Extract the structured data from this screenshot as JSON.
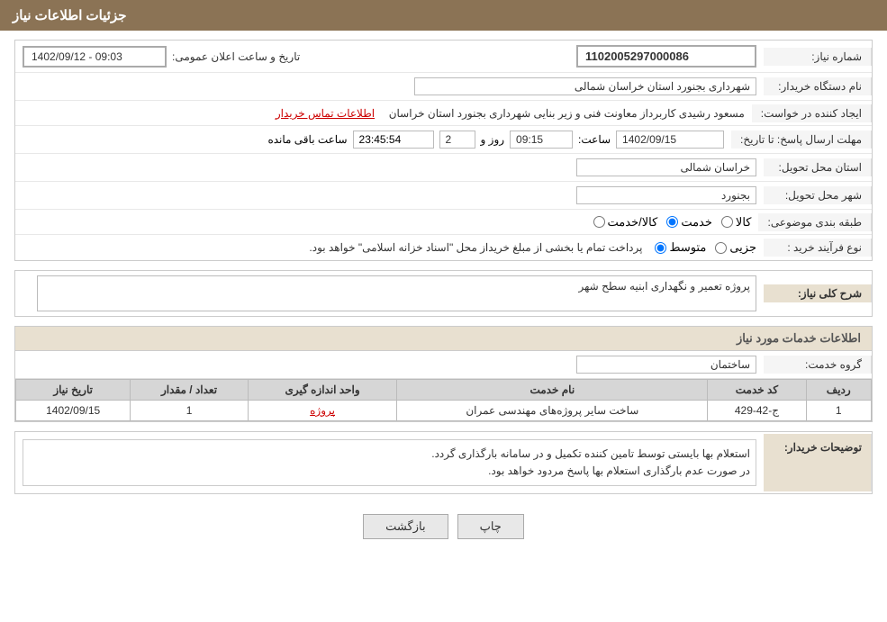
{
  "page": {
    "header_title": "جزئیات اطلاعات نیاز",
    "sections": {
      "need_info": {
        "rows": [
          {
            "label": "شماره نیاز:",
            "value": "1102005297000086",
            "type": "number"
          },
          {
            "label": "نام دستگاه خریدار:",
            "value": "شهرداری بجنورد استان خراسان شمالی",
            "type": "input"
          },
          {
            "label": "ایجاد کننده در خواست:",
            "main_text": "مسعود رشیدی کاربرداز معاونت فنی و زیر بنایی شهرداری بجنورد استان خراسان",
            "link_text": "اطلاعات تماس خریدار",
            "type": "link_row"
          },
          {
            "label": "مهلت ارسال پاسخ: تا تاریخ:",
            "date_value": "1402/09/15",
            "time_label": "ساعت:",
            "time_value": "09:15",
            "day_label": "روز و",
            "day_value": "2",
            "remaining_label": "ساعت باقی مانده",
            "remaining_value": "23:45:54",
            "type": "deadline"
          },
          {
            "label": "استان محل تحویل:",
            "value": "خراسان شمالی",
            "type": "input"
          },
          {
            "label": "شهر محل تحویل:",
            "value": "بجنورد",
            "type": "input"
          },
          {
            "label": "طبقه بندی موضوعی:",
            "options": [
              "کالا",
              "خدمت",
              "کالا/خدمت"
            ],
            "selected": "خدمت",
            "type": "radio"
          },
          {
            "label": "نوع فرآیند خرید :",
            "options": [
              "جزیی",
              "متوسط"
            ],
            "note": "پرداخت تمام یا بخشی از مبلغ خریداز محل \"اسناد خزانه اسلامی\" خواهد بود.",
            "type": "process_radio"
          }
        ]
      },
      "general_description_label": "شرح کلی نیاز:",
      "general_description_value": "پروژه تعمیر و نگهداری ابنیه سطح شهر",
      "services_section_header": "اطلاعات خدمات مورد نیاز",
      "service_group_label": "گروه خدمت:",
      "service_group_value": "ساختمان",
      "table": {
        "headers": [
          "ردیف",
          "کد خدمت",
          "نام خدمت",
          "واحد اندازه گیری",
          "تعداد / مقدار",
          "تاریخ نیاز"
        ],
        "rows": [
          {
            "row_num": "1",
            "code": "ج-42-429",
            "name": "ساخت سایر پروژه‌های مهندسی عمران",
            "unit": "پروژه",
            "quantity": "1",
            "date": "1402/09/15"
          }
        ]
      },
      "buyer_notes_label": "توضیحات خریدار:",
      "buyer_notes_value": "استعلام بها بایستی توسط تامین کننده تکمیل و در سامانه بارگذاری گردد.\nدر صورت عدم بارگذاری استعلام بها پاسخ مردود خواهد بود.",
      "buttons": {
        "print": "چاپ",
        "back": "بازگشت"
      },
      "announcement_label": "تاریخ و ساعت اعلان عمومی:",
      "announcement_value": "1402/09/12 - 09:03"
    }
  }
}
